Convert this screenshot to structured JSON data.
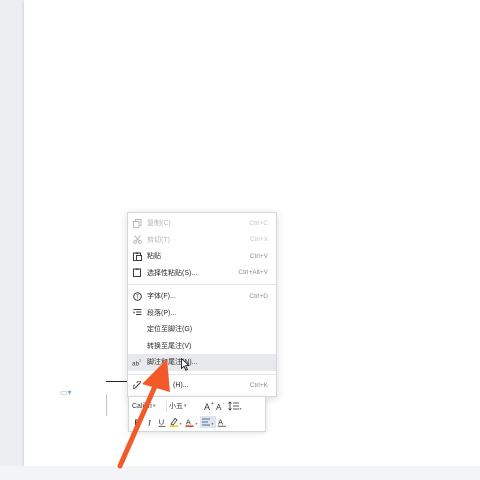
{
  "context_menu": {
    "items": [
      {
        "label": "复制(C)",
        "shortcut": "Ctrl+C",
        "icon": "copy-icon",
        "disabled": true
      },
      {
        "label": "剪切(T)",
        "shortcut": "Ctrl+X",
        "icon": "scissors-icon",
        "disabled": true
      },
      {
        "label": "粘贴",
        "shortcut": "Ctrl+V",
        "icon": "paste-icon",
        "disabled": false
      },
      {
        "label": "选择性粘贴(S)...",
        "shortcut": "Ctrl+Alt+V",
        "icon": "paste-special-icon",
        "disabled": false
      },
      {
        "label": "字体(F)...",
        "shortcut": "Ctrl+D",
        "icon": "font-icon",
        "disabled": false
      },
      {
        "label": "段落(P)...",
        "shortcut": "",
        "icon": "paragraph-icon",
        "disabled": false
      },
      {
        "label": "定位至脚注(G)",
        "shortcut": "",
        "icon": "",
        "disabled": false
      },
      {
        "label": "转换至尾注(V)",
        "shortcut": "",
        "icon": "",
        "disabled": false
      },
      {
        "label": "脚注和尾注(N)...",
        "shortcut": "",
        "icon": "footnote-icon",
        "disabled": false,
        "highlighted": true
      },
      {
        "label": "(H)...",
        "shortcut": "Ctrl+K",
        "icon": "hyperlink-icon",
        "disabled": false
      }
    ]
  },
  "mini_toolbar": {
    "font_name": "Calibri",
    "font_size": "小五"
  },
  "colors": {
    "arrow": "#f25a2a",
    "menu_highlight": "#e8e9ec",
    "highlighter_yellow": "#f2d21a",
    "font_color_red": "#e23b2e"
  }
}
